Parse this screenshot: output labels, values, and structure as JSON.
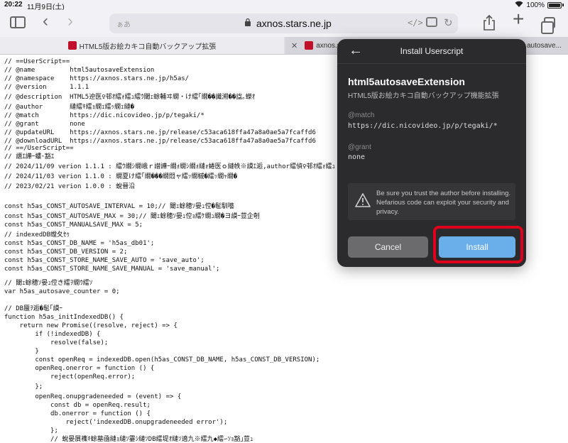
{
  "status": {
    "time": "20:22",
    "date": "11月9日(土)",
    "wifi": "wifi",
    "battery_text": "100%"
  },
  "toolbar": {
    "placeholder": "ぁあ",
    "url": "axnos.stars.ne.jp",
    "code_icon": "</>"
  },
  "tabs": [
    {
      "label": "HTML5版お絵カキコ自動バックアップ拡張"
    },
    {
      "label": "axnos.st"
    },
    {
      "label": "autosave..."
    }
  ],
  "code_lines": [
    {
      "text": "// ==UserScript==",
      "y": 0
    },
    {
      "text": "// @name         html5autosaveExtension",
      "y": 1
    },
    {
      "text": "// @namespace    https://axnos.stars.ne.jp/h5as/",
      "y": 2
    },
    {
      "text": "// @version      1.1.1",
      "y": 3
    },
    {
      "text": "// @description  HTML5迚医♀邨ｵ繧ｫ繧ｭ繧ｳ閾ｪ蜍輔ヰ繝・け繧｢繝��讖溯��諡｡蠑ｵ",
      "y": 4
    },
    {
      "text": "// @author       縺繧ｷ繧ｮ繝ｪ繧ｯ繝ｪ縺�",
      "y": 5
    },
    {
      "text": "// @match        https://dic.nicovideo.jp/p/tegaki/*",
      "y": 6
    },
    {
      "text": "// @grant        none",
      "y": 7
    },
    {
      "text": "// @updateURL    https://axnos.stars.ne.jp/release/c53aca618ffa47a8a0ae5a7fcaffd6",
      "y": 8
    },
    {
      "text": "// @downloadURL  https://axnos.stars.ne.jp/release/c53aca618ffa47a8a0ae5a7fcaffd6",
      "y": 9
    },
    {
      "text": "// ==/UserScript==",
      "y": 10
    },
    {
      "text": "// 譖ｴ譁ｰ螻･豁ｴ",
      "y": 11
    },
    {
      "text": "// 2024/11/09 verion 1.1.1 : 繧ｳ繝ｼ繝峨ｒ譛譁ｰ繝ｫ繝ｼ繝ｫ縺ｫ蜷医ｏ縺帙※謨ｴ逅,author繧偵♀邨ｵ繧ｫ繧ｭ",
      "y": 12
    },
    {
      "text": "// 2024/11/03 verion 1.1.0 : 繝夏け繧｢繝���繝悶ャ繧ｯ繝槭�繧ｯ繝ｬ繝�",
      "y": 13
    },
    {
      "text": "// 2023/02/21 verion 1.0.0 : 蛻晉沿",
      "y": 14
    },
    {
      "text": "const h5as_CONST_AUTOSAVE_INTERVAL = 10;// 閾ｪ蜍穂ｿ晏ｭ倥�髢馴囈",
      "y": 15
    },
    {
      "text": "const h5as_CONST_AUTOSAVE_MAX = 30;// 閾ｪ蜍穂ｿ晏ｭ倥ｮ繧ｹ繝ｭ繝�ヨ謨ｰ荳企剞",
      "y": 16
    },
    {
      "text": "const h5as_CONST_MANUALSAVE_MAX = 5;",
      "y": 17
    },
    {
      "text": "// indexedDB螳夂ｾｩ",
      "y": 18
    },
    {
      "text": "const h5as_CONST_DB_NAME = 'h5as_db01';",
      "y": 19
    },
    {
      "text": "const h5as_CONST_DB_VERSION = 2;",
      "y": 20
    },
    {
      "text": "const h5as_CONST_STORE_NAME_SAVE_AUTO = 'save_auto';",
      "y": 21
    },
    {
      "text": "const h5as_CONST_STORE_NAME_SAVE_MANUAL = 'save_manual';",
      "y": 22
    },
    {
      "text": "// 閾ｪ蜍穂ｿ晏ｭ倥き繧ｦ繝ｳ繧ｿ",
      "y": 23
    },
    {
      "text": "var h5as_autosave_counter = 0;",
      "y": 24
    },
    {
      "text": "// DB蜃ｦ逅�髢｢謨ｰ",
      "y": 25
    },
    {
      "text": "function h5as_initIndexedDB() {",
      "y": 26
    },
    {
      "text": "    return new Promise((resolve, reject) => {",
      "y": 27
    },
    {
      "text": "        if (!indexedDB) {",
      "y": 28
    },
    {
      "text": "            resolve(false);",
      "y": 29
    },
    {
      "text": "        }",
      "y": 30
    },
    {
      "text": "        const openReq = indexedDB.open(h5as_CONST_DB_NAME, h5as_CONST_DB_VERSION);",
      "y": 31
    },
    {
      "text": "        openReq.onerror = function () {",
      "y": 32
    },
    {
      "text": "            reject(openReq.error);",
      "y": 33
    },
    {
      "text": "        };",
      "y": 34
    },
    {
      "text": "        openReq.onupgradeneeded = (event) => {",
      "y": 35
    },
    {
      "text": "            const db = openReq.result;",
      "y": 36
    },
    {
      "text": "            db.onerror = function () {",
      "y": 37
    },
    {
      "text": "                reject('indexedDB.onupgradeneeded error');",
      "y": 38
    },
    {
      "text": "            };",
      "y": 39
    },
    {
      "text": "            // 蛻晏屓襍ｷ蜍墓凾縺ｮ縺ｿ霎ｼ縺ｿDB繧堤ｵ縺ｿ遶九※繧九◆繧∽ｿｮ豁｣荳ｭ",
      "y": 40
    }
  ],
  "panel": {
    "title": "Install Userscript",
    "script_name": "html5autosaveExtension",
    "script_desc": "HTML5版お絵カキコ自動バックアップ機能拡張",
    "match_label": "@match",
    "match_value": "https://dic.nicovideo.jp/p/tegaki/*",
    "grant_label": "@grant",
    "grant_value": "none",
    "warning": "Be sure you trust the author before installing. Nefarious code can exploit your security and privacy.",
    "cancel_label": "Cancel",
    "install_label": "Install"
  }
}
